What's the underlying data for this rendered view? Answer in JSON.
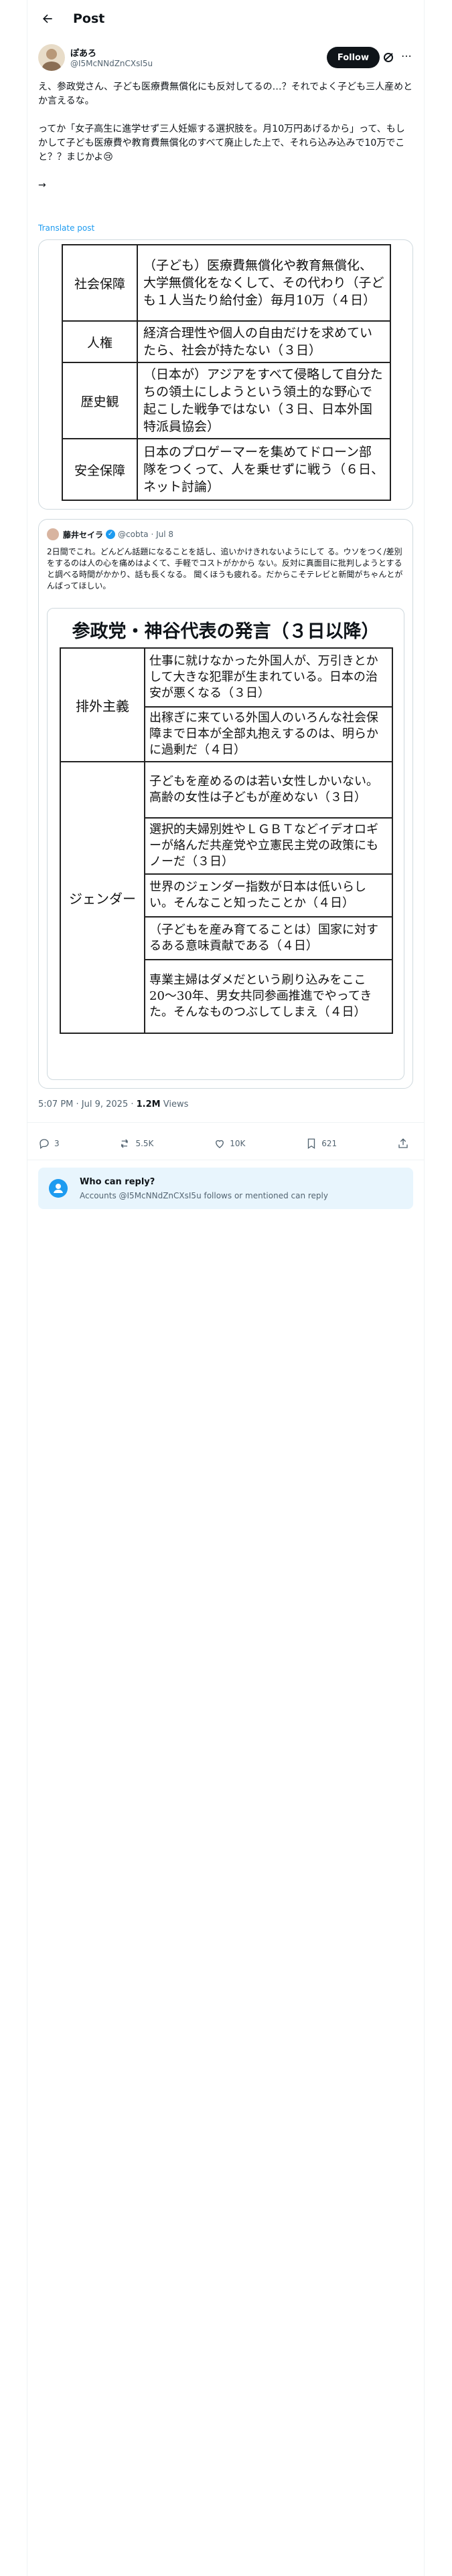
{
  "header": {
    "title": "Post"
  },
  "post": {
    "author_name": "ぽあろ",
    "handle": "@I5McNNdZnCXsI5u",
    "follow_label": "Follow",
    "text": "え、参政党さん、子ども医療費無償化にも反対してるの…？それでよく子ども三人産めとか言えるな。\n\nってか「女子高生に進学せず三人妊娠する選択肢を。月10万円あげるから」って、もしかして子ども医療費や教育費無償化のすべて廃止した上で、それら込み込みで10万でこと？？まじかよ😢\n\n→",
    "translate": "Translate post"
  },
  "media_table": [
    {
      "key": "社会保障",
      "value": "（子ども）医療費無償化や教育無償化、大学無償化をなくして、その代わり（子ども１人当たり給付金）毎月10万（４日）"
    },
    {
      "key": "人権",
      "value": "経済合理性や個人の自由だけを求めていたら、社会が持たない（３日）"
    },
    {
      "key": "歴史観",
      "value": "（日本が）アジアをすべて侵略して自分たちの領土にしようという領土的な野心で起こした戦争ではない（３日、日本外国特派員協会）"
    },
    {
      "key": "安全保障",
      "value": "日本のプロゲーマーを集めてドローン部隊をつくって、人を乗せずに戦う（６日、ネット討論）"
    }
  ],
  "quote": {
    "author_name": "藤井セイラ",
    "handle": "@cobta",
    "date": "Jul 8",
    "text": "2日間でこれ。どんどん話題になることを話し、追いかけきれないようにして る。ウソをつく/差別をするのは人の心を痛めはよくて、手軽でコストがかから ない。反対に真面目に批判しようとすると調べる時間がかかり、話も長くなる。 聞くほうも疲れる。だからこそテレビと新聞がちゃんとがんばってほしい。",
    "image_title": "参政党・神谷代表の発言（３日以降）",
    "rows": [
      {
        "key": "排外主義",
        "value": "仕事に就けなかった外国人が、万引きとかして大きな犯罪が生まれている。日本の治安が悪くなる（３日）"
      },
      {
        "key": "",
        "value": "出稼ぎに来ている外国人のいろんな社会保障まで日本が全部丸抱えするのは、明らかに過剰だ（４日）"
      },
      {
        "key": "ジェンダー",
        "value": "子どもを産めるのは若い女性しかいない。高齢の女性は子どもが産めない（３日）"
      },
      {
        "key": "",
        "value": "選択的夫婦別姓やＬＧＢＴなどイデオロギーが絡んだ共産党や立憲民主党の政策にもノーだ（３日）"
      },
      {
        "key": "",
        "value": "世界のジェンダー指数が日本は低いらしい。そんなこと知ったことか（４日）"
      },
      {
        "key": "",
        "value": "（子どもを産み育てることは）国家に対するある意味貢献である（４日）"
      },
      {
        "key": "",
        "value": "専業主婦はダメだという刷り込みをここ20〜30年、男女共同参画推進でやってきた。そんなものつぶしてしまえ（４日）"
      }
    ]
  },
  "meta": {
    "time": "5:07 PM · Jul 9, 2025 · ",
    "views": "1.2M",
    "views_label": " Views"
  },
  "actions": {
    "replies": "3",
    "reposts": "5.5K",
    "likes": "10K",
    "bookmarks": "621"
  },
  "reply_box": {
    "title": "Who can reply?",
    "subtitle": "Accounts @I5McNNdZnCXsI5u follows or mentioned can reply"
  },
  "colors": {
    "accent": "#1d9bf0",
    "text": "#0f1419",
    "muted": "#536471",
    "border": "#cfd9de"
  }
}
